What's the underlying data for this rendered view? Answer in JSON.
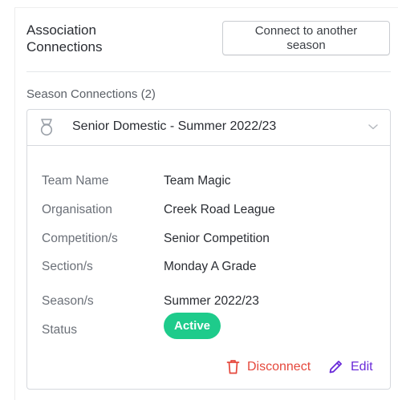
{
  "header": {
    "title": "Association Connections",
    "connect_button": "Connect to another season"
  },
  "season_connections": {
    "label": "Season Connections (2)",
    "card": {
      "title": "Senior Domestic - Summer 2022/23",
      "rows": [
        {
          "label": "Team Name",
          "value": "Team Magic"
        },
        {
          "label": "Organisation",
          "value": "Creek Road League"
        },
        {
          "label": "Competition/s",
          "value": "Senior Competition"
        },
        {
          "label": "Section/s",
          "value": "Monday A Grade"
        },
        {
          "label": "Season/s",
          "value": "Summer 2022/23"
        }
      ],
      "status_label": "Status",
      "status_value": "Active",
      "disconnect_label": "Disconnect",
      "edit_label": "Edit"
    }
  },
  "colors": {
    "status_active": "#1ecb8b",
    "disconnect": "#e5483c",
    "edit": "#6a2bd9"
  },
  "icons": {
    "card": "medal-icon",
    "expand": "chevron-down-icon",
    "disconnect": "trash-icon",
    "edit": "pencil-icon"
  }
}
